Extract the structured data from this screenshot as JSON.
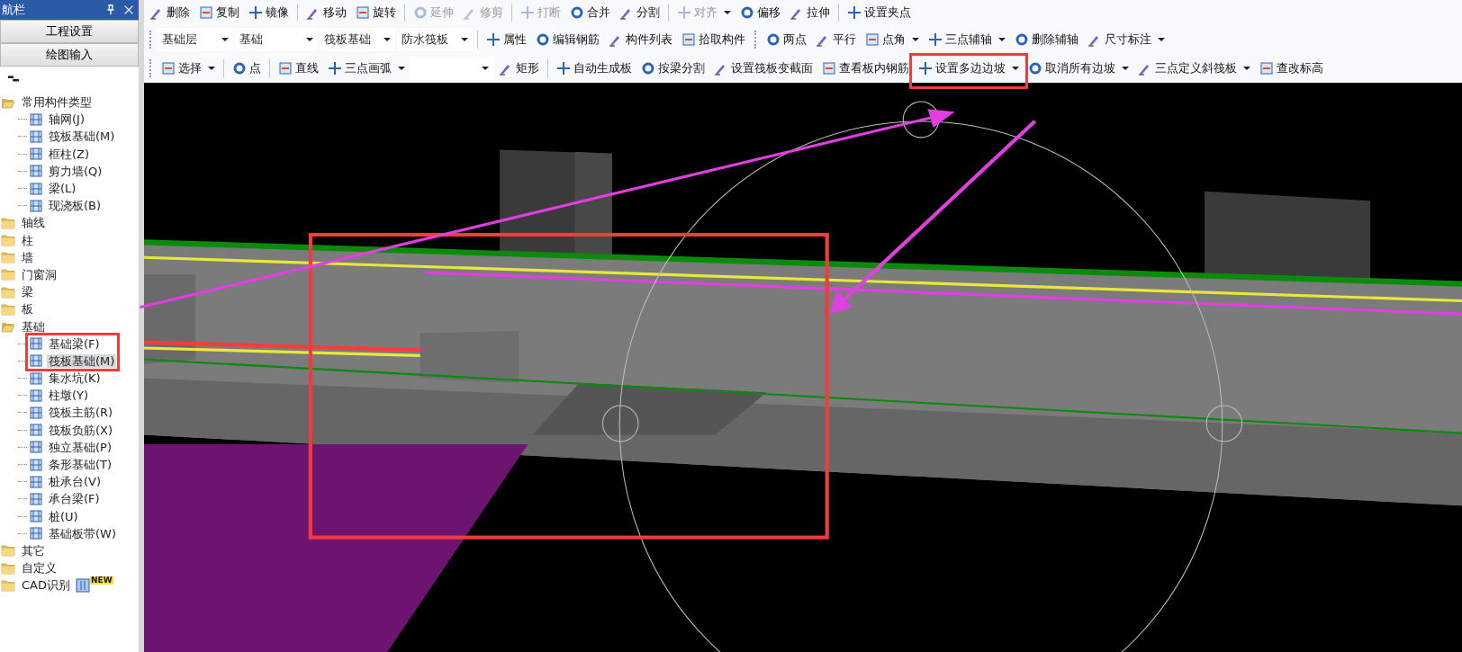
{
  "navigator": {
    "title": "航栏",
    "buttons": [
      "工程设置",
      "绘图输入"
    ],
    "tree": [
      {
        "label": "常用构件类型",
        "expanded": true,
        "children": [
          {
            "label": "轴网(J)",
            "selected": false
          },
          {
            "label": "筏板基础(M)",
            "selected": false
          },
          {
            "label": "框柱(Z)",
            "selected": false
          },
          {
            "label": "剪力墙(Q)",
            "selected": false
          },
          {
            "label": "梁(L)",
            "selected": false
          },
          {
            "label": "现浇板(B)",
            "selected": false
          }
        ]
      },
      {
        "label": "轴线",
        "expanded": false
      },
      {
        "label": "柱",
        "expanded": false
      },
      {
        "label": "墙",
        "expanded": false
      },
      {
        "label": "门窗洞",
        "expanded": false
      },
      {
        "label": "梁",
        "expanded": false
      },
      {
        "label": "板",
        "expanded": false
      },
      {
        "label": "基础",
        "expanded": true,
        "children": [
          {
            "label": "基础梁(F)",
            "selected": false
          },
          {
            "label": "筏板基础(M)",
            "selected": true
          },
          {
            "label": "集水坑(K)",
            "selected": false
          },
          {
            "label": "柱墩(Y)",
            "selected": false
          },
          {
            "label": "筏板主筋(R)",
            "selected": false
          },
          {
            "label": "筏板负筋(X)",
            "selected": false
          },
          {
            "label": "独立基础(P)",
            "selected": false
          },
          {
            "label": "条形基础(T)",
            "selected": false
          },
          {
            "label": "桩承台(V)",
            "selected": false
          },
          {
            "label": "承台梁(F)",
            "selected": false
          },
          {
            "label": "桩(U)",
            "selected": false
          },
          {
            "label": "基础板带(W)",
            "selected": false
          }
        ]
      },
      {
        "label": "其它",
        "expanded": false
      },
      {
        "label": "自定义",
        "expanded": false
      },
      {
        "label": "CAD识别",
        "expanded": false,
        "badge": "NEW"
      }
    ]
  },
  "toolbar_rows": [
    [
      {
        "kind": "button",
        "label": "删除",
        "dropdown": false,
        "disabled": false
      },
      {
        "kind": "button",
        "label": "复制",
        "dropdown": false,
        "disabled": false
      },
      {
        "kind": "button",
        "label": "镜像",
        "dropdown": false,
        "disabled": false
      },
      {
        "kind": "separator"
      },
      {
        "kind": "button",
        "label": "移动",
        "dropdown": false,
        "disabled": false
      },
      {
        "kind": "button",
        "label": "旋转",
        "dropdown": false,
        "disabled": false
      },
      {
        "kind": "separator"
      },
      {
        "kind": "button",
        "label": "延伸",
        "dropdown": false,
        "disabled": true
      },
      {
        "kind": "button",
        "label": "修剪",
        "dropdown": false,
        "disabled": true
      },
      {
        "kind": "separator"
      },
      {
        "kind": "button",
        "label": "打断",
        "dropdown": false,
        "disabled": true
      },
      {
        "kind": "button",
        "label": "合并",
        "dropdown": false,
        "disabled": false
      },
      {
        "kind": "button",
        "label": "分割",
        "dropdown": false,
        "disabled": false
      },
      {
        "kind": "separator"
      },
      {
        "kind": "button",
        "label": "对齐",
        "dropdown": true,
        "disabled": true
      },
      {
        "kind": "button",
        "label": "偏移",
        "dropdown": false,
        "disabled": false
      },
      {
        "kind": "button",
        "label": "拉伸",
        "dropdown": false,
        "disabled": false
      },
      {
        "kind": "separator"
      },
      {
        "kind": "button",
        "label": "设置夹点",
        "dropdown": false,
        "disabled": false
      }
    ],
    [
      {
        "kind": "grip"
      },
      {
        "kind": "combo",
        "value": "基础层",
        "wide": false
      },
      {
        "kind": "combo",
        "value": "基础",
        "wide": true
      },
      {
        "kind": "combo",
        "value": "筏板基础",
        "wide": false
      },
      {
        "kind": "combo",
        "value": "防水筏板",
        "wide": false
      },
      {
        "kind": "separator"
      },
      {
        "kind": "button",
        "label": "属性",
        "dropdown": false,
        "disabled": false
      },
      {
        "kind": "button",
        "label": "编辑钢筋",
        "dropdown": false,
        "disabled": false
      },
      {
        "kind": "button",
        "label": "构件列表",
        "dropdown": false,
        "disabled": false
      },
      {
        "kind": "button",
        "label": "拾取构件",
        "dropdown": false,
        "disabled": false
      },
      {
        "kind": "grip"
      },
      {
        "kind": "button",
        "label": "两点",
        "dropdown": false,
        "disabled": false
      },
      {
        "kind": "button",
        "label": "平行",
        "dropdown": false,
        "disabled": false
      },
      {
        "kind": "button",
        "label": "点角",
        "dropdown": true,
        "disabled": false
      },
      {
        "kind": "button",
        "label": "三点辅轴",
        "dropdown": true,
        "disabled": false
      },
      {
        "kind": "button",
        "label": "删除辅轴",
        "dropdown": false,
        "disabled": false
      },
      {
        "kind": "button",
        "label": "尺寸标注",
        "dropdown": true,
        "disabled": false
      }
    ],
    [
      {
        "kind": "grip"
      },
      {
        "kind": "button",
        "label": "选择",
        "dropdown": true,
        "disabled": false
      },
      {
        "kind": "separator"
      },
      {
        "kind": "button",
        "label": "点",
        "dropdown": false,
        "disabled": false
      },
      {
        "kind": "separator"
      },
      {
        "kind": "button",
        "label": "直线",
        "dropdown": false,
        "disabled": false
      },
      {
        "kind": "button",
        "label": "三点画弧",
        "dropdown": true,
        "disabled": false
      },
      {
        "kind": "combo",
        "wide": true
      },
      {
        "kind": "button",
        "label": "矩形",
        "dropdown": false,
        "disabled": false
      },
      {
        "kind": "separator"
      },
      {
        "kind": "button",
        "label": "自动生成板",
        "dropdown": false,
        "disabled": false
      },
      {
        "kind": "button",
        "label": "按梁分割",
        "dropdown": false,
        "disabled": false
      },
      {
        "kind": "button",
        "label": "设置筏板变截面",
        "dropdown": false,
        "disabled": false
      },
      {
        "kind": "button",
        "label": "查看板内钢筋",
        "dropdown": false,
        "disabled": false
      },
      {
        "kind": "button",
        "label": "设置多边边坡",
        "dropdown": true,
        "disabled": false
      },
      {
        "kind": "button",
        "label": "取消所有边坡",
        "dropdown": true,
        "disabled": false
      },
      {
        "kind": "button",
        "label": "三点定义斜筏板",
        "dropdown": true,
        "disabled": false
      },
      {
        "kind": "button",
        "label": "查改标高",
        "dropdown": false,
        "disabled": false
      }
    ]
  ]
}
